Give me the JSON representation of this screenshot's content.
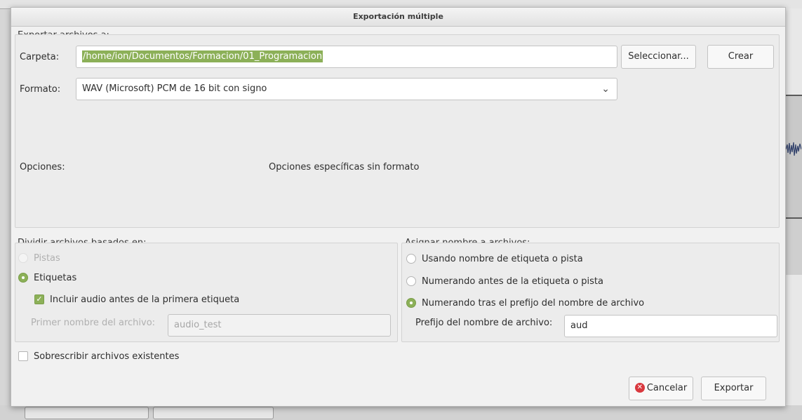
{
  "dialog": {
    "title": "Exportación múltiple"
  },
  "export_to": {
    "section_label": "Exportar archivos a:",
    "folder_label": "Carpeta:",
    "folder_value": "/home/ion/Documentos/Formacion/01_Programacion",
    "select_button": "Seleccionar...",
    "create_button": "Crear",
    "format_label": "Formato:",
    "format_value": "WAV (Microsoft) PCM de 16 bit con signo",
    "options_label": "Opciones:",
    "options_text": "Opciones específicas sin formato"
  },
  "split": {
    "section_label": "Dividir archivos basados en:",
    "tracks_label": "Pistas",
    "tracks_enabled": false,
    "labels_label": "Etiquetas",
    "labels_selected": true,
    "include_audio_label": "Incluir audio antes de la primera etiqueta",
    "include_audio_checked": true,
    "first_name_label": "Primer nombre del archivo:",
    "first_name_value": "audio_test"
  },
  "naming": {
    "section_label": "Asignar nombre a archivos:",
    "option1": "Usando nombre de etiqueta o pista",
    "option2": "Numerando antes de la etiqueta o pista",
    "option3": "Numerando tras el prefijo del nombre de archivo",
    "selected_option": 3,
    "prefix_label": "Prefijo del nombre de archivo:",
    "prefix_value": "aud"
  },
  "overwrite": {
    "label": "Sobrescribir archivos existentes",
    "checked": false
  },
  "buttons": {
    "cancel": "Cancelar",
    "export": "Exportar"
  },
  "colors": {
    "accent": "#8cb058",
    "cancel_icon": "#d9383e",
    "dialog_bg": "#f1f1f1"
  }
}
